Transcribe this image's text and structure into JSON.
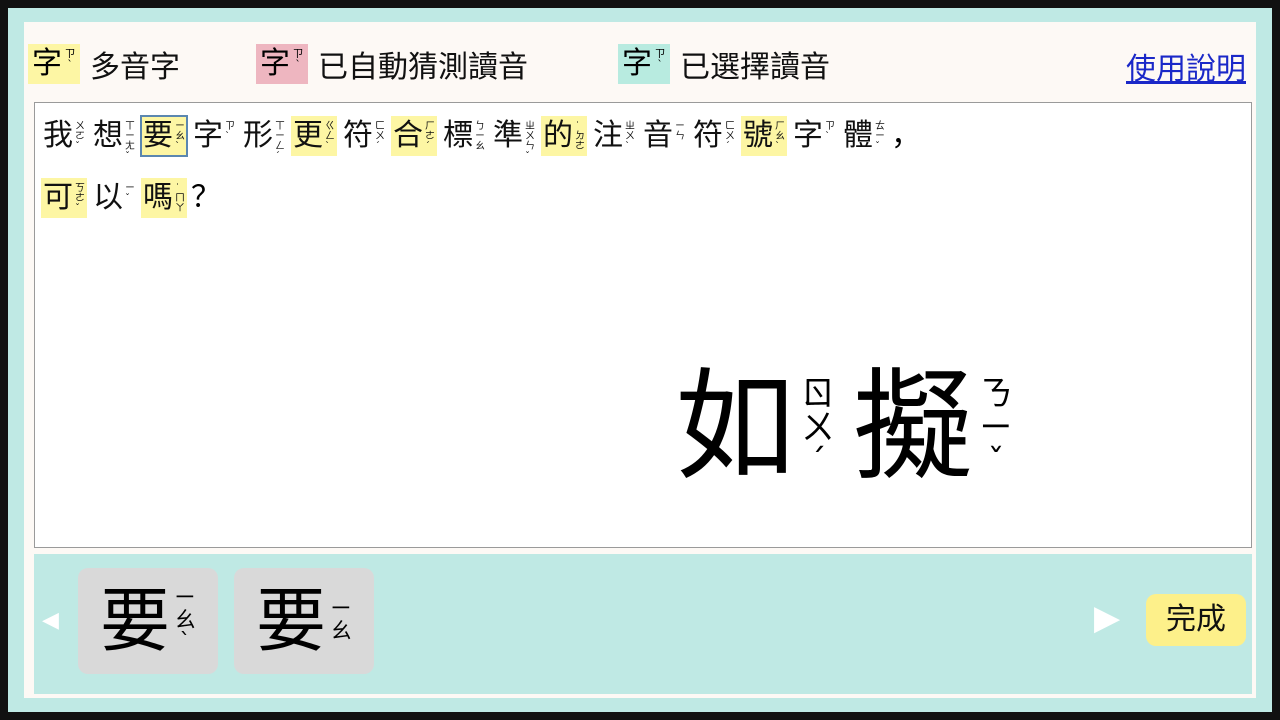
{
  "legend": [
    {
      "char": "字",
      "zhuyin": "ㄗˋ",
      "label": "多音字",
      "color": "#fdf6a4"
    },
    {
      "char": "字",
      "zhuyin": "ㄗˋ",
      "label": "已自動猜測讀音",
      "color": "#eeb6c0"
    },
    {
      "char": "字",
      "zhuyin": "ㄗˋ",
      "label": "已選擇讀音",
      "color": "#b8ebe0"
    }
  ],
  "help_label": "使用說明",
  "text_lines": [
    [
      {
        "c": "我",
        "z": "ㄨㄛˇ",
        "hl": ""
      },
      {
        "c": "想",
        "z": "ㄒㄧㄤˇ",
        "hl": ""
      },
      {
        "c": "要",
        "z": "ㄧㄠˋ",
        "hl": "selected"
      },
      {
        "c": "字",
        "z": "ㄗˋ",
        "hl": ""
      },
      {
        "c": "形",
        "z": "ㄒㄧㄥˊ",
        "hl": ""
      },
      {
        "c": "更",
        "z": "ㄍㄥˋ",
        "hl": "yellow"
      },
      {
        "c": "符",
        "z": "ㄈㄨˊ",
        "hl": ""
      },
      {
        "c": "合",
        "z": "ㄏㄜˊ",
        "hl": "yellow"
      },
      {
        "c": "標",
        "z": "ㄅㄧㄠ",
        "hl": ""
      },
      {
        "c": "準",
        "z": "ㄓㄨㄣˇ",
        "hl": ""
      },
      {
        "c": "的",
        "z": "˙ㄉㄜ",
        "hl": "yellow"
      },
      {
        "c": "注",
        "z": "ㄓㄨˋ",
        "hl": ""
      },
      {
        "c": "音",
        "z": "ㄧㄣ",
        "hl": ""
      },
      {
        "c": "符",
        "z": "ㄈㄨˊ",
        "hl": ""
      },
      {
        "c": "號",
        "z": "ㄏㄠˋ",
        "hl": "yellow"
      },
      {
        "c": "字",
        "z": "ㄗˋ",
        "hl": ""
      },
      {
        "c": "體",
        "z": "ㄊㄧˇ",
        "hl": ""
      },
      {
        "c": "，",
        "z": "",
        "hl": ""
      }
    ],
    [
      {
        "c": "可",
        "z": "ㄎㄜˇ",
        "hl": "yellow"
      },
      {
        "c": "以",
        "z": "ㄧˇ",
        "hl": ""
      },
      {
        "c": "嗎",
        "z": "˙ㄇㄚ",
        "hl": "yellow"
      },
      {
        "c": "？",
        "z": "",
        "hl": ""
      }
    ]
  ],
  "preview": [
    {
      "c": "如",
      "z": "ㄖㄨˊ"
    },
    {
      "c": "擬",
      "z": "ㄋㄧˇ"
    }
  ],
  "candidates": [
    {
      "c": "要",
      "z": "ㄧㄠˋ"
    },
    {
      "c": "要",
      "z": "ㄧㄠ"
    }
  ],
  "nav": {
    "prev_icon": "◀",
    "next_icon": "▶"
  },
  "done_label": "完成"
}
